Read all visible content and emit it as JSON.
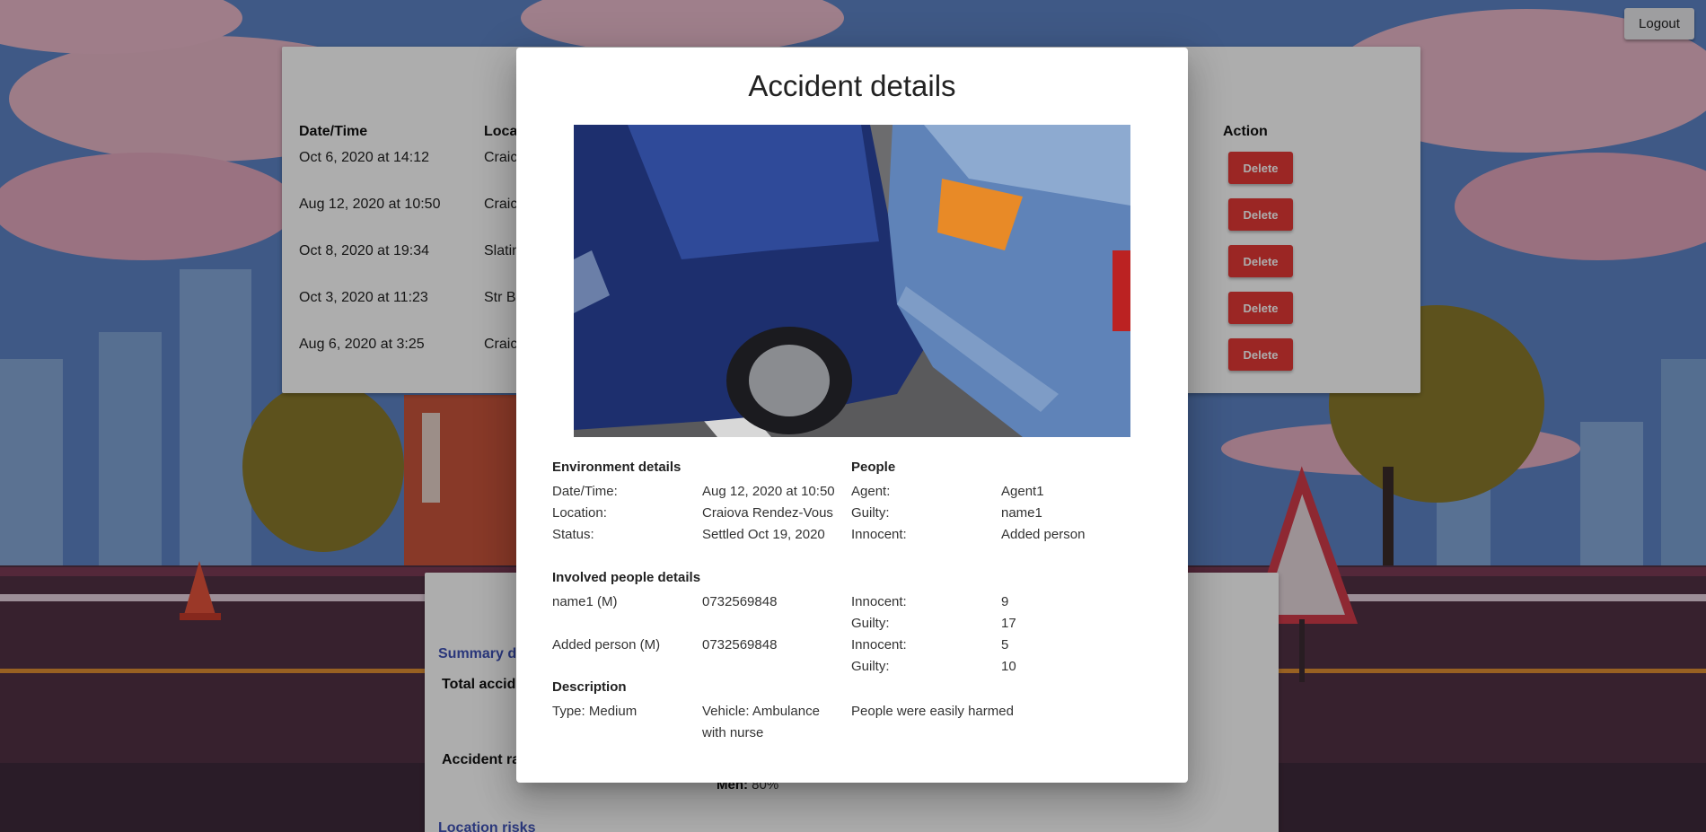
{
  "header": {
    "logout_label": "Logout"
  },
  "table": {
    "headers": {
      "datetime": "Date/Time",
      "location": "Loca",
      "action": "Action"
    },
    "rows": [
      {
        "datetime": "Oct 6, 2020 at 14:12",
        "location": "Craic",
        "action": "Delete"
      },
      {
        "datetime": "Aug 12, 2020 at 10:50",
        "location": "Craic",
        "action": "Delete"
      },
      {
        "datetime": "Oct 8, 2020 at 19:34",
        "location": "Slatin",
        "action": "Delete"
      },
      {
        "datetime": "Oct 3, 2020 at 11:23",
        "location": "Str B",
        "action": "Delete"
      },
      {
        "datetime": "Aug 6, 2020 at 3:25",
        "location": "Craic",
        "action": "Delete"
      }
    ]
  },
  "summary": {
    "link": "Summary de",
    "total_label": "Total accide",
    "rate_label": "Accident ra",
    "men_label": "Men:",
    "men_value": "80%",
    "location_link": "Location risks"
  },
  "modal": {
    "title": "Accident details",
    "environment": {
      "heading": "Environment details",
      "rows": [
        {
          "label": "Date/Time:",
          "value": "Aug 12, 2020 at 10:50"
        },
        {
          "label": "Location:",
          "value": "Craiova Rendez-Vous"
        },
        {
          "label": "Status:",
          "value": "Settled Oct 19, 2020"
        }
      ]
    },
    "people": {
      "heading": "People",
      "rows": [
        {
          "label": "Agent:",
          "value": "Agent1"
        },
        {
          "label": "Guilty:",
          "value": "name1"
        },
        {
          "label": "Innocent:",
          "value": "Added person"
        }
      ]
    },
    "involved": {
      "heading": "Involved people details",
      "persons": [
        {
          "name": "name1 (M)",
          "phone": "0732569848",
          "innocent_label": "Innocent:",
          "innocent": "9",
          "guilty_label": "Guilty:",
          "guilty": "17"
        },
        {
          "name": "Added person (M)",
          "phone": "0732569848",
          "innocent_label": "Innocent:",
          "innocent": "5",
          "guilty_label": "Guilty:",
          "guilty": "10"
        }
      ]
    },
    "description": {
      "heading": "Description",
      "type": "Type: Medium",
      "vehicle": "Vehicle: Ambulance with nurse",
      "text": "People were easily harmed"
    }
  },
  "colors": {
    "delete": "#e53935",
    "link": "#3f51b5",
    "overlay": "rgba(0,0,0,0.32)"
  }
}
